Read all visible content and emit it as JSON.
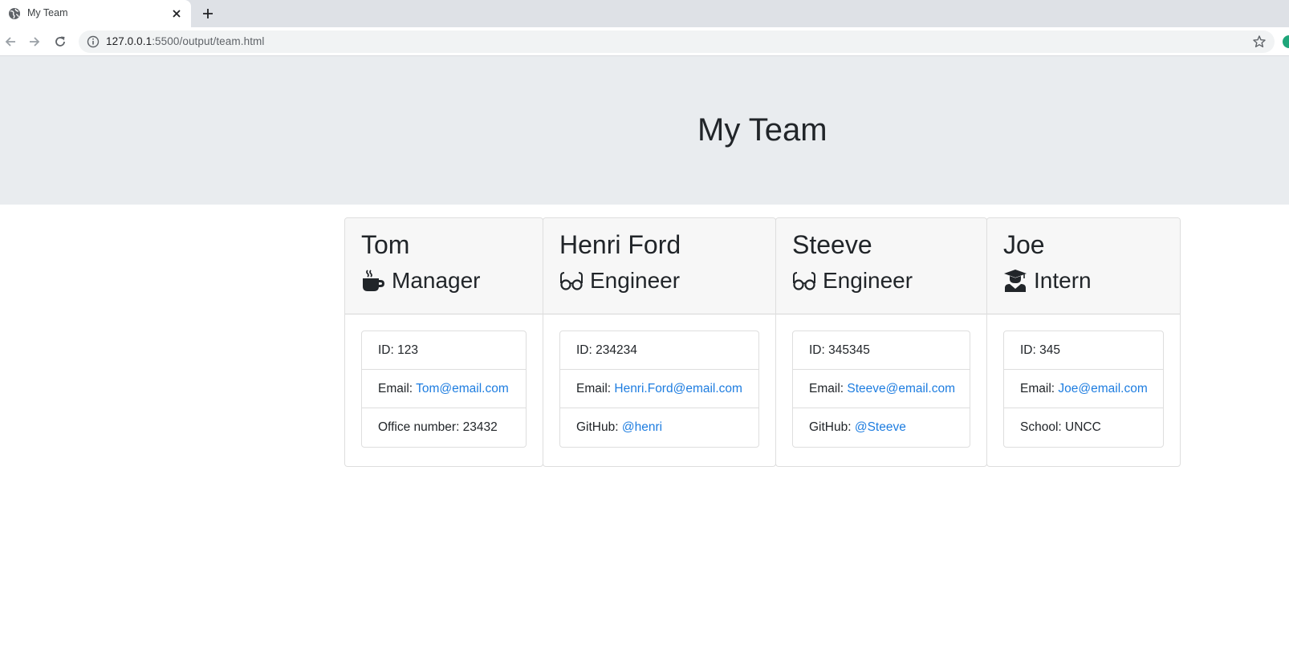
{
  "browser": {
    "tab_title": "My Team",
    "url_host": "127.0.0.1",
    "url_rest": ":5500/output/team.html",
    "icons": [
      "globe-icon",
      "close-icon",
      "plus-icon",
      "back-icon",
      "forward-icon",
      "reload-icon",
      "info-icon",
      "star-icon"
    ]
  },
  "page": {
    "heading": "My Team"
  },
  "cards": [
    {
      "name": "Tom",
      "role": "Manager",
      "role_icon": "coffee-icon",
      "id_label": "ID: 123",
      "email_label": "Email: ",
      "email": "Tom@email.com",
      "extra_label": "Office number: 23432",
      "extra_link": ""
    },
    {
      "name": "Henri Ford",
      "role": "Engineer",
      "role_icon": "glasses-icon",
      "id_label": "ID: 234234",
      "email_label": "Email: ",
      "email": "Henri.Ford@email.com",
      "extra_label": "GitHub: ",
      "extra_link": "@henri"
    },
    {
      "name": "Steeve",
      "role": "Engineer",
      "role_icon": "glasses-icon",
      "id_label": "ID: 345345",
      "email_label": "Email: ",
      "email": "Steeve@email.com",
      "extra_label": "GitHub: ",
      "extra_link": "@Steeve"
    },
    {
      "name": "Joe",
      "role": "Intern",
      "role_icon": "graduate-icon",
      "id_label": "ID: 345",
      "email_label": "Email: ",
      "email": "Joe@email.com",
      "extra_label": "School: UNCC",
      "extra_link": ""
    }
  ],
  "colors": {
    "link": "#1e7de0",
    "jumbotron": "#e9ecef",
    "card_header": "#f7f7f7",
    "text": "#212529"
  }
}
